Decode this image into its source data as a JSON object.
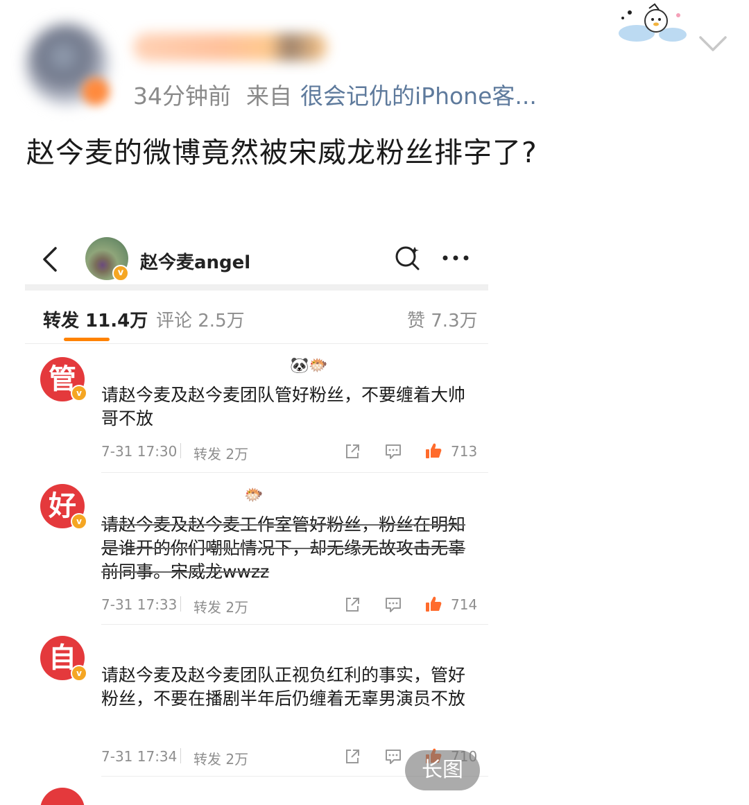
{
  "post": {
    "time": "34分钟前",
    "from_label": "来自",
    "source": "很会记仇的iPhone客...",
    "text": "赵今麦的微博竟然被宋威龙粉丝排字了?"
  },
  "screenshot": {
    "profile_name": "赵今麦angel",
    "tabs": [
      {
        "label": "转发 11.4万",
        "active": true
      },
      {
        "label": "评论 2.5万",
        "active": false
      },
      {
        "label": "赞 7.3万",
        "active": false
      }
    ],
    "reposts": [
      {
        "avatar_char": "管",
        "text": "请赵今麦及赵今麦团队管好粉丝，不要缠着大帅哥不放",
        "time": "7-31 17:30",
        "forward": "转发 2万",
        "likes": "713",
        "emojis": "🐼🐡"
      },
      {
        "avatar_char": "好",
        "text": "请赵今麦及赵今麦工作室管好粉丝，粉丝在明知是谁开的你们嘲贴情况下，却无缘无故攻击无辜前同事。宋威龙wwzz",
        "time": "7-31 17:33",
        "forward": "转发 2万",
        "likes": "714",
        "emojis": "🐡"
      },
      {
        "avatar_char": "自",
        "text": "请赵今麦及赵今麦团队正视负红利的事实，管好粉丝，不要在播剧半年后仍缠着无辜男演员不放",
        "time": "7-31 17:34",
        "forward": "转发 2万",
        "likes": "710",
        "emojis": ""
      }
    ],
    "verified_badge": "v"
  },
  "long_image_label": "长图",
  "colors": {
    "accent": "#ff8200",
    "avatar_red": "#e4393c",
    "link": "#5e7a9c",
    "badge": "#f5a623"
  },
  "icons": [
    "chevron-down-icon",
    "back-icon",
    "search-icon",
    "more-icon",
    "share-icon",
    "comment-icon",
    "like-icon",
    "sticker-icon"
  ]
}
